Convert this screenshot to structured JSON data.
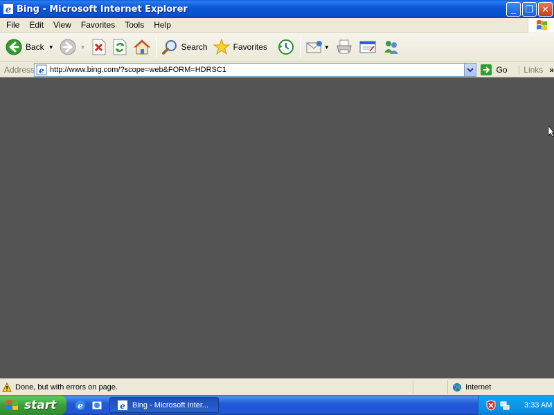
{
  "window": {
    "title": "Bing - Microsoft Internet Explorer"
  },
  "menu": [
    "File",
    "Edit",
    "View",
    "Favorites",
    "Tools",
    "Help"
  ],
  "toolbar": {
    "back_label": "Back",
    "search_label": "Search",
    "favorites_label": "Favorites"
  },
  "address": {
    "label": "Address",
    "url": "http://www.bing.com/?scope=web&FORM=HDRSC1",
    "go_label": "Go",
    "links_label": "Links"
  },
  "status": {
    "text": "Done, but with errors on page.",
    "zone": "Internet"
  },
  "taskbar": {
    "start_label": "start",
    "task_label": "Bing - Microsoft Inter...",
    "clock": "3:33 AM"
  },
  "colors": {
    "content_bg": "#545454",
    "titlebar": "#0a58d6",
    "taskbar": "#2157d7",
    "start": "#3aa13a"
  }
}
